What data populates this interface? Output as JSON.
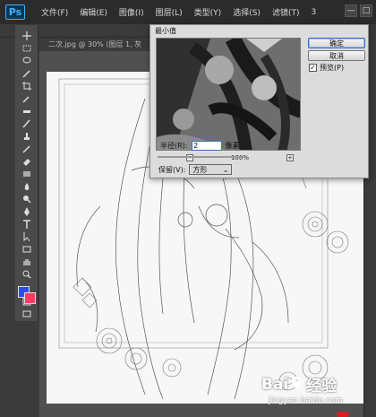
{
  "app": {
    "logo": "Ps"
  },
  "menu": [
    "文件(F)",
    "编辑(E)",
    "图像(I)",
    "图层(L)",
    "类型(Y)",
    "选择(S)",
    "滤镜(T)",
    "3"
  ],
  "window_controls": [
    "—",
    "□"
  ],
  "doc_tab": {
    "title": "二次.jpg @ 30% (图层 1, 灰"
  },
  "toolbar": {
    "tools": [
      "move-tool",
      "marquee-tool",
      "lasso-tool",
      "quick-select-tool",
      "crop-tool",
      "eyedropper-tool",
      "healing-tool",
      "brush-tool",
      "clone-stamp-tool",
      "history-brush-tool",
      "eraser-tool",
      "gradient-tool",
      "blur-tool",
      "dodge-tool",
      "pen-tool",
      "type-tool",
      "path-select-tool",
      "shape-tool",
      "hand-tool",
      "zoom-tool"
    ],
    "colors": {
      "foreground": "#2f49ff",
      "background": "#ff3a64"
    }
  },
  "dialog": {
    "title": "最小值",
    "ok_label": "确定",
    "cancel_label": "取消",
    "preview_label": "预览(P)",
    "preview_checked": true,
    "zoom_out": "−",
    "zoom_in": "+",
    "zoom_level": "100%",
    "radius_label": "半径(R):",
    "radius_value": "2",
    "radius_unit": "像素",
    "preserve_label": "保留(V):",
    "preserve_value": "方形"
  },
  "watermark": {
    "brand": "Bai",
    "brand2": "经验",
    "url": "jingyan.baidu.com"
  }
}
